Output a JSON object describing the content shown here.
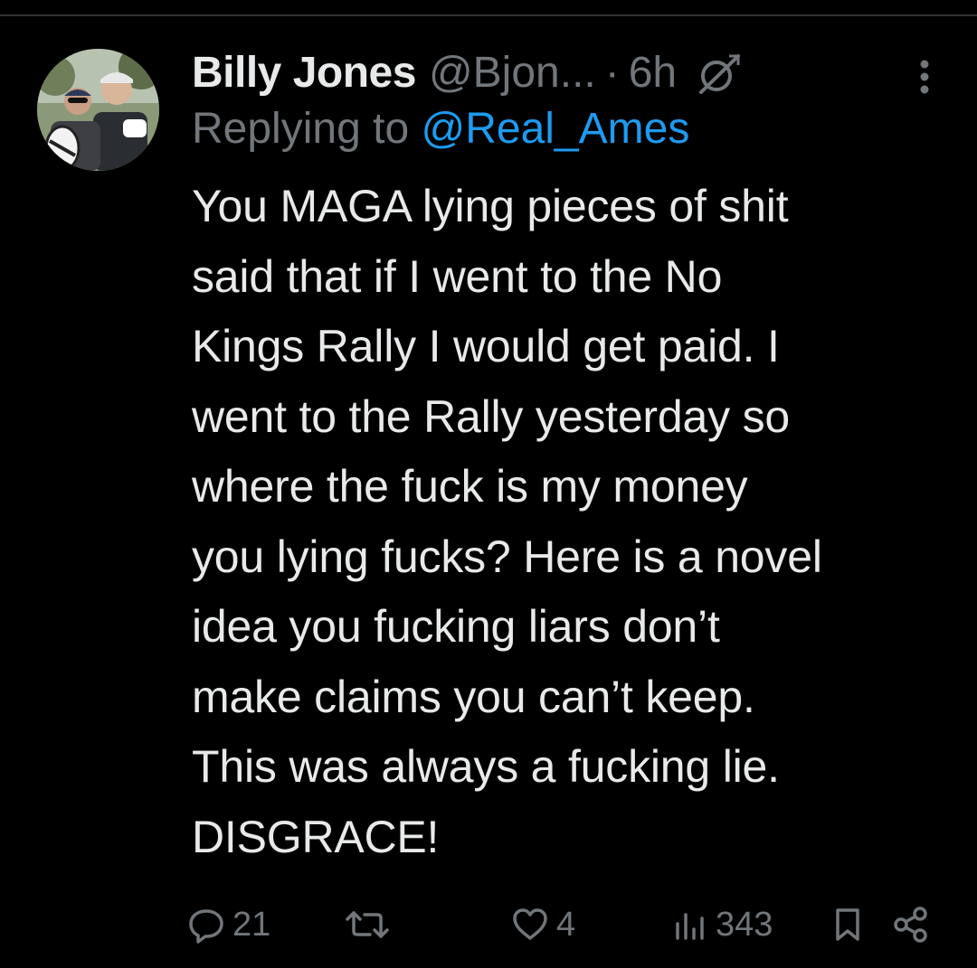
{
  "tweet": {
    "author": {
      "display_name": "Billy Jones",
      "handle": "@Bjon...",
      "avatar_icon": "profile-photo"
    },
    "separator": "·",
    "time": "6h",
    "reply_prefix": "Replying to",
    "reply_to": "@Real_Ames",
    "text_lines": [
      "You MAGA lying pieces of shit",
      "said that if I went to the No",
      "Kings Rally I would get paid. I",
      "went to the Rally yesterday so",
      "where the fuck is my money",
      "you lying fucks? Here is a novel",
      "idea you fucking liars don’t",
      "make claims you can’t keep.",
      "This was always a fucking lie.",
      "DISGRACE!"
    ],
    "actions": {
      "reply_count": "21",
      "retweet_count": "",
      "like_count": "4",
      "view_count": "343"
    }
  },
  "colors": {
    "background": "#000000",
    "primary_text": "#e7e9ea",
    "secondary_text": "#71767b",
    "accent": "#1d9bf0",
    "divider": "#2f3336"
  },
  "icons": [
    "grok-icon",
    "more-icon",
    "reply-icon",
    "retweet-icon",
    "like-icon",
    "views-icon",
    "bookmark-icon",
    "share-icon"
  ]
}
